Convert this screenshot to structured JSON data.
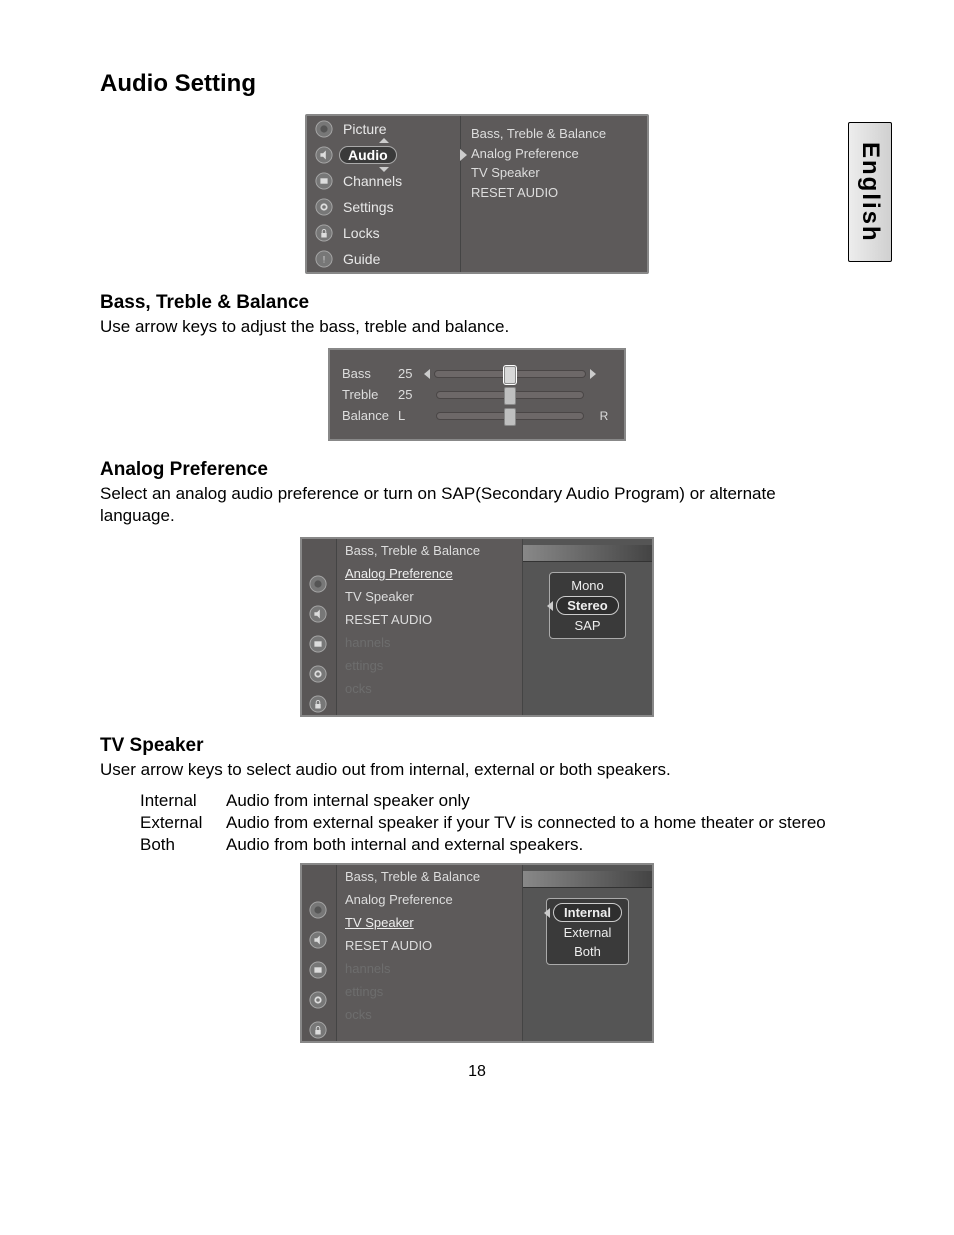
{
  "page": {
    "title": "Audio Setting",
    "lang_tab": "English",
    "page_number": "18"
  },
  "main_menu": {
    "items": [
      {
        "label": "Picture",
        "selected": false
      },
      {
        "label": "Audio",
        "selected": true
      },
      {
        "label": "Channels",
        "selected": false
      },
      {
        "label": "Settings",
        "selected": false
      },
      {
        "label": "Locks",
        "selected": false
      },
      {
        "label": "Guide",
        "selected": false
      }
    ],
    "submenu": [
      "Bass, Treble & Balance",
      "Analog Preference",
      "TV Speaker",
      "RESET AUDIO"
    ]
  },
  "bass_treble": {
    "heading": "Bass, Treble & Balance",
    "desc": "Use arrow keys to adjust the bass, treble and balance.",
    "rows": [
      {
        "label": "Bass",
        "value": "25",
        "left": "",
        "right": "",
        "selected": true,
        "pos": 50
      },
      {
        "label": "Treble",
        "value": "25",
        "left": "",
        "right": "",
        "selected": false,
        "pos": 50
      },
      {
        "label": "Balance",
        "value": "L",
        "left": "",
        "right": "R",
        "selected": false,
        "pos": 50
      }
    ]
  },
  "analog": {
    "heading": "Analog Preference",
    "desc": "Select an analog audio preference or turn on SAP(Secondary Audio Program) or alternate language.",
    "submenu": [
      {
        "label": "Bass, Treble & Balance",
        "state": "normal"
      },
      {
        "label": "Analog Preference",
        "state": "ul"
      },
      {
        "label": "TV Speaker",
        "state": "normal"
      },
      {
        "label": "RESET AUDIO",
        "state": "normal"
      },
      {
        "label": "hannels",
        "state": "dim"
      },
      {
        "label": "ettings",
        "state": "dim"
      },
      {
        "label": "ocks",
        "state": "dim"
      }
    ],
    "options": [
      {
        "label": "Mono",
        "selected": false
      },
      {
        "label": "Stereo",
        "selected": true
      },
      {
        "label": "SAP",
        "selected": false
      }
    ]
  },
  "tvspeaker": {
    "heading": "TV Speaker",
    "desc": "User arrow keys to select audio out from internal, external or both speakers.",
    "defs": [
      {
        "term": "Internal",
        "def": "Audio from internal speaker only"
      },
      {
        "term": "External",
        "def": "Audio from external speaker if your TV is connected to a home theater or stereo"
      },
      {
        "term": "Both",
        "def": "Audio from both internal and external speakers."
      }
    ],
    "submenu": [
      {
        "label": "Bass, Treble & Balance",
        "state": "normal"
      },
      {
        "label": "Analog Preference",
        "state": "normal"
      },
      {
        "label": "TV Speaker",
        "state": "ul"
      },
      {
        "label": "RESET AUDIO",
        "state": "normal"
      },
      {
        "label": "hannels",
        "state": "dim"
      },
      {
        "label": "ettings",
        "state": "dim"
      },
      {
        "label": "ocks",
        "state": "dim"
      }
    ],
    "options": [
      {
        "label": "Internal",
        "selected": true
      },
      {
        "label": "External",
        "selected": false
      },
      {
        "label": "Both",
        "selected": false
      }
    ]
  }
}
